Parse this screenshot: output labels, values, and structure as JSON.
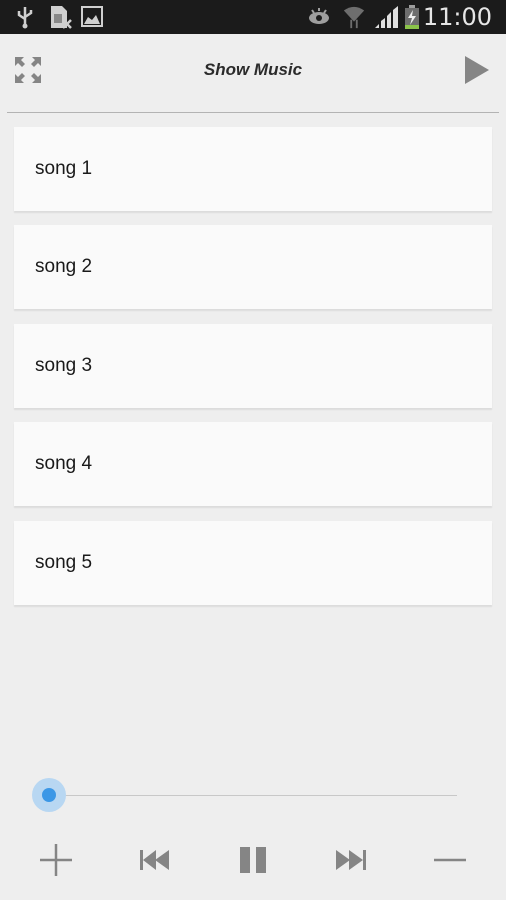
{
  "status_bar": {
    "time": "11:00",
    "icons_left": [
      "usb-icon",
      "sim-error-icon",
      "gallery-icon"
    ],
    "icons_right": [
      "eye-icon",
      "wifi-icon",
      "signal-icon",
      "battery-charging-icon"
    ],
    "battery_color": "#8bc34a"
  },
  "action_bar": {
    "title": "Show Music",
    "left_icon": "fullscreen-icon",
    "right_icon": "play-icon"
  },
  "songs": [
    {
      "label": "song 1"
    },
    {
      "label": "song 2"
    },
    {
      "label": "song 3"
    },
    {
      "label": "song 4"
    },
    {
      "label": "song 5"
    }
  ],
  "player": {
    "seek_progress": 0,
    "accent_color": "#3b97e6",
    "controls": [
      "add",
      "previous",
      "pause",
      "next",
      "remove"
    ]
  }
}
